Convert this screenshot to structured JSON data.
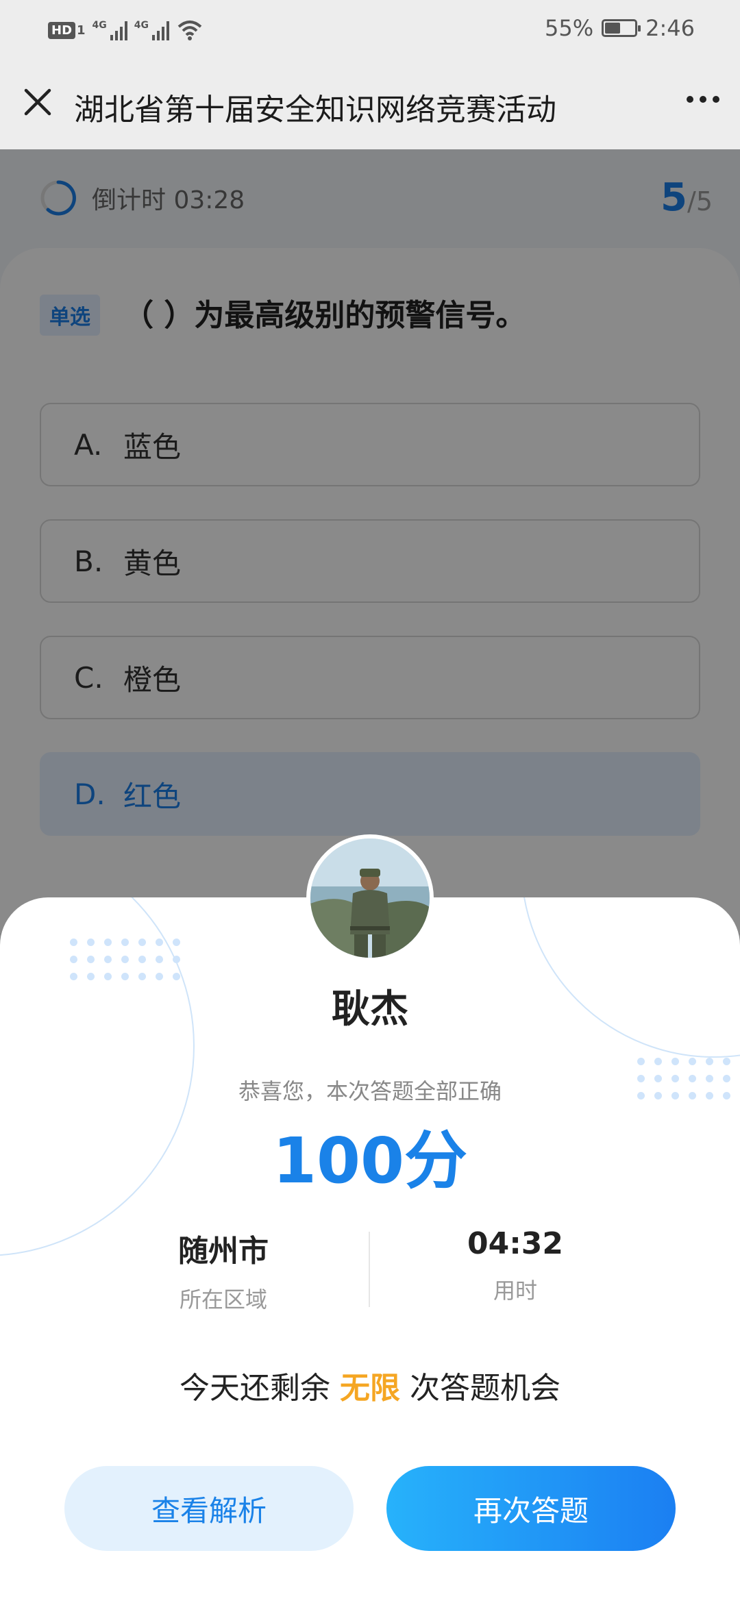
{
  "status_bar": {
    "hd": "HD",
    "hd_sub": "1",
    "net1": "4G",
    "net2": "4G",
    "battery": "55%",
    "battery_level": 0.55,
    "time": "2:46"
  },
  "nav": {
    "title": "湖北省第十届安全知识网络竞赛活动",
    "close_icon": "close-icon",
    "more_icon": "more-icon"
  },
  "quiz": {
    "timer_label": "倒计时 03:28",
    "current": "5",
    "total": "/5",
    "question_type": "单选",
    "question": "（ ）为最高级别的预警信号。",
    "options": [
      {
        "letter": "A.",
        "text": "蓝色"
      },
      {
        "letter": "B.",
        "text": "黄色"
      },
      {
        "letter": "C.",
        "text": "橙色"
      },
      {
        "letter": "D.",
        "text": "红色"
      }
    ],
    "selected_option": "D.",
    "accent": "#1a7ee8"
  },
  "result": {
    "name": "耿杰",
    "congrats": "恭喜您，本次答题全部正确",
    "score": "100分",
    "region_value": "随州市",
    "region_label": "所在区域",
    "time_value": "04:32",
    "time_label": "用时",
    "remain_prefix": "今天还剩余 ",
    "remain_highlight": "无限",
    "remain_suffix": " 次答题机会",
    "review_button": "查看解析",
    "retry_button": "再次答题"
  }
}
